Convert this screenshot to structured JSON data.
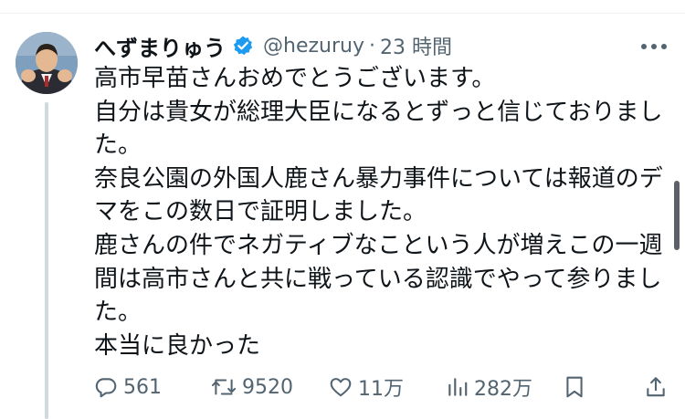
{
  "tweet": {
    "display_name": "へずまりゅう",
    "handle": "@hezuruy",
    "separator": "·",
    "time": "23 時間",
    "verified_icon": "verified-badge-icon",
    "more_icon": "more-icon",
    "text": [
      "高市早苗さんおめでとうございます。",
      "自分は貴女が総理大臣になるとずっと信じておりました。",
      "奈良公園の外国人鹿さん暴力事件については報道のデマをこの数日で証明しました。",
      "鹿さんの件でネガティブなこという人が増えこの一週間は高市さんと共に戦っている認識でやって参りました。",
      "本当に良かった"
    ],
    "actions": {
      "reply": {
        "icon": "reply-icon",
        "count": "561"
      },
      "retweet": {
        "icon": "retweet-icon",
        "count": "9520"
      },
      "like": {
        "icon": "heart-icon",
        "count": "11万"
      },
      "views": {
        "icon": "views-icon",
        "count": "282万"
      },
      "bookmark": {
        "icon": "bookmark-icon"
      },
      "share": {
        "icon": "share-icon"
      }
    }
  },
  "colors": {
    "text_primary": "#0f1419",
    "text_secondary": "#536471",
    "verified_blue": "#1d9bf0",
    "thread_line": "#cfd9de"
  }
}
